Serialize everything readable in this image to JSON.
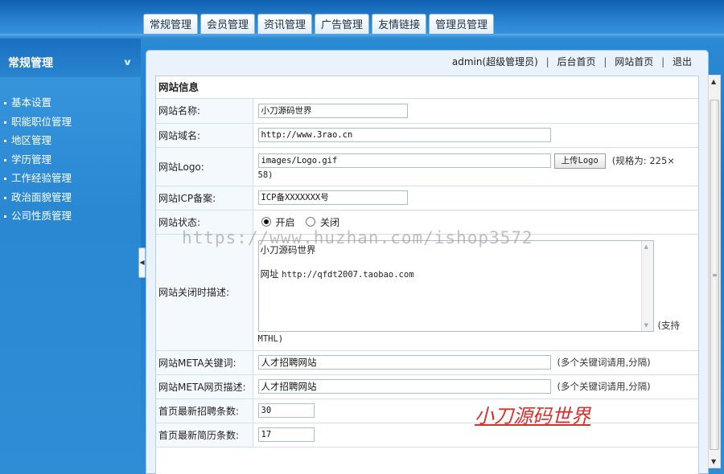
{
  "nav": {
    "tabs": [
      "常规管理",
      "会员管理",
      "资讯管理",
      "广告管理",
      "友情链接",
      "管理员管理"
    ]
  },
  "sidebar": {
    "title": "常规管理",
    "items": [
      "基本设置",
      "职能职位管理",
      "地区管理",
      "学历管理",
      "工作经验管理",
      "政治面貌管理",
      "公司性质管理"
    ]
  },
  "topbar": {
    "user": "admin(超级管理员)",
    "links": [
      "后台首页",
      "网站首页",
      "退出"
    ]
  },
  "form": {
    "section_title": "网站信息",
    "site_name_label": "网站名称:",
    "site_name_value": "小刀源码世界",
    "domain_label": "网站域名:",
    "domain_value": "http://www.3rao.cn",
    "logo_label": "网站Logo:",
    "logo_value": "images/Logo.gif",
    "logo_upload": "上传Logo",
    "logo_note": "(规格为: 225×",
    "logo_note_cont": "58)",
    "icp_label": "网站ICP备案:",
    "icp_value": "ICP备XXXXXXX号",
    "status_label": "网站状态:",
    "status_open": "开启",
    "status_close": "关闭",
    "status_selected": "开启",
    "closed_desc_label": "网站关闭时描述:",
    "closed_desc_line1": "小刀源码世界",
    "closed_desc_line2_prefix": "网址",
    "closed_desc_line2_url": "http://qfdt2007.taobao.com",
    "closed_desc_note": "(支持",
    "closed_desc_note_cont": "MTHL)",
    "meta_kw_label": "网站META关键词:",
    "meta_kw_value": "人才招聘网站",
    "meta_kw_note": "(多个关键词请用,分隔)",
    "meta_desc_label": "网站META网页描述:",
    "meta_desc_value": "人才招聘网站",
    "meta_desc_note": "(多个关键词请用,分隔)",
    "home_jobs_label": "首页最新招聘条数:",
    "home_jobs_value": "30",
    "home_resumes_label": "首页最新简历条数:",
    "home_resumes_value": "17"
  },
  "overlay": {
    "watermark": "https://www.huzhan.com/ishop3572",
    "stamp": "小刀源码世界"
  }
}
